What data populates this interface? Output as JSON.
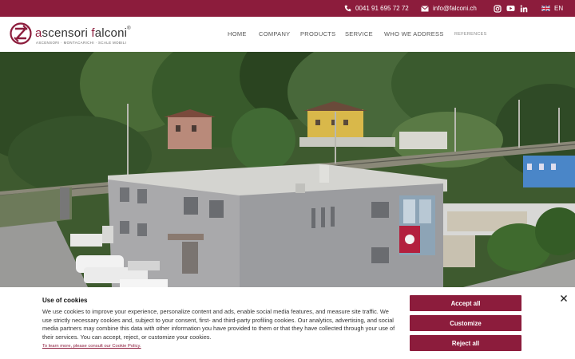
{
  "topbar": {
    "phone_icon": "phone-icon",
    "phone": "0041 91 695 72 72",
    "email_icon": "mail-icon",
    "email": "info@falconi.ch",
    "social_icons": [
      "instagram-icon",
      "youtube-icon",
      "linkedin-icon"
    ],
    "language_flag": "uk-flag-icon",
    "language": "EN",
    "bg_color": "#8c1c3c"
  },
  "header": {
    "logo_first_letter": "a",
    "logo_rest": "scensori ",
    "logo_f": "f",
    "logo_rest2": "alconi",
    "logo_registered": "®",
    "logo_tagline": "ASCENSORI · MONTACARICHI · SCALE MOBILI",
    "nav": [
      "HOME",
      "COMPANY",
      "PRODUCTS",
      "SERVICE",
      "WHO WE ADDRESS",
      "REFERENCES"
    ]
  },
  "cookie": {
    "title": "Use of cookies",
    "text": "We use cookies to improve your experience, personalize content and ads, enable social media features, and measure site traffic. We use strictly necessary cookies and, subject to your consent, first- and third-party profiling cookies. Our analytics, advertising, and social media partners may combine this data with other information you have provided to them or that they have collected through your use of their services. You can accept, reject, or customize your cookies.",
    "link": "To learn more, please consult our Cookie Policy.",
    "accept": "Accept all",
    "customize": "Customize",
    "reject": "Reject all",
    "close_icon": "close-icon"
  }
}
